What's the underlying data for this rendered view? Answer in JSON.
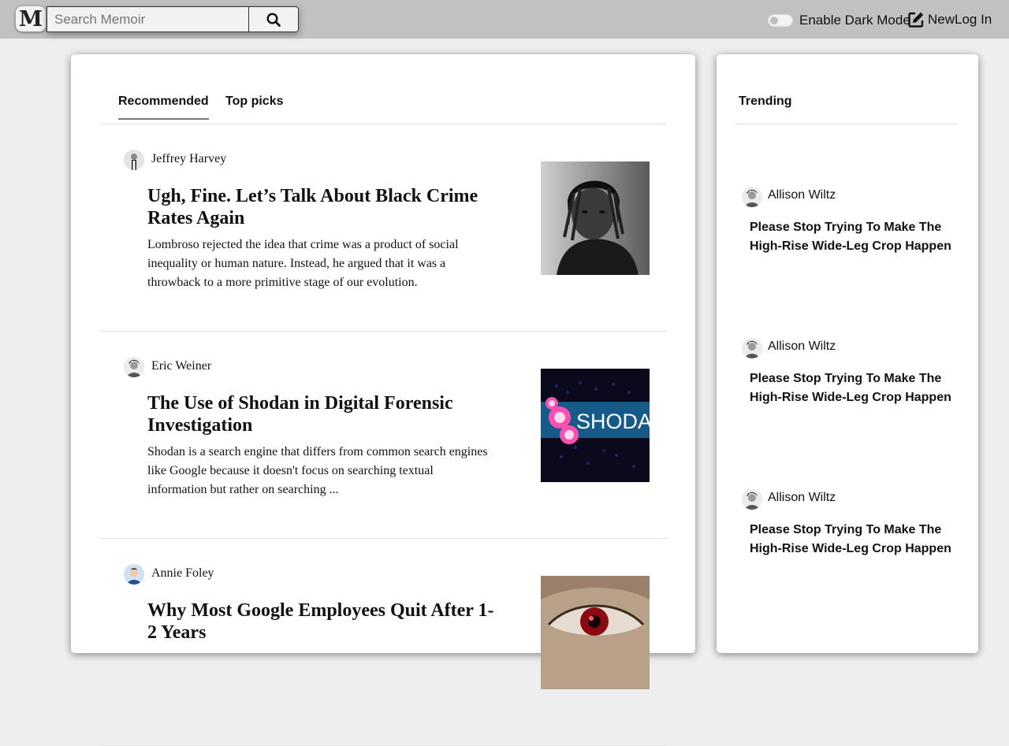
{
  "header": {
    "logo_letter": "M",
    "search_placeholder": "Search Memoir",
    "dark_mode_label": "Enable Dark Mode",
    "new_label": "New",
    "login_label": "Log In"
  },
  "tabs": [
    {
      "label": "Recommended",
      "active": true
    },
    {
      "label": "Top picks",
      "active": false
    }
  ],
  "articles": [
    {
      "author": "Jeffrey Harvey",
      "title": "Ugh, Fine. Let’s Talk About Black Crime Rates Again",
      "excerpt": "Lombroso rejected the idea that crime was a product of social inequality or human nature. Instead, he argued that it was a throwback to a more primitive stage of our evolution.",
      "image": "portrait-photo"
    },
    {
      "author": "Eric Weiner",
      "title": "The Use of Shodan in Digital Forensic Investigation",
      "excerpt": "Shodan is a search engine that differs from common search engines like Google because it doesn't focus on searching textual information but rather on searching ...",
      "image_text": "SHODAN"
    },
    {
      "author": "Annie Foley",
      "title": "Why Most Google Employees Quit After 1-2 Years",
      "excerpt": "",
      "image": "eye-closeup"
    }
  ],
  "sidebar": {
    "heading": "Trending",
    "items": [
      {
        "author": "Allison Wiltz",
        "title": "Please Stop Trying To Make The High-Rise Wide-Leg Crop Happen"
      },
      {
        "author": "Allison Wiltz",
        "title": "Please Stop Trying To Make The High-Rise Wide-Leg Crop Happen"
      },
      {
        "author": "Allison Wiltz",
        "title": "Please Stop Trying To Make The High-Rise Wide-Leg Crop Happen"
      }
    ]
  },
  "colors": {
    "topbar": "#c1c1c3",
    "page_bg": "#eeeeee",
    "card_bg": "#ffffff"
  }
}
